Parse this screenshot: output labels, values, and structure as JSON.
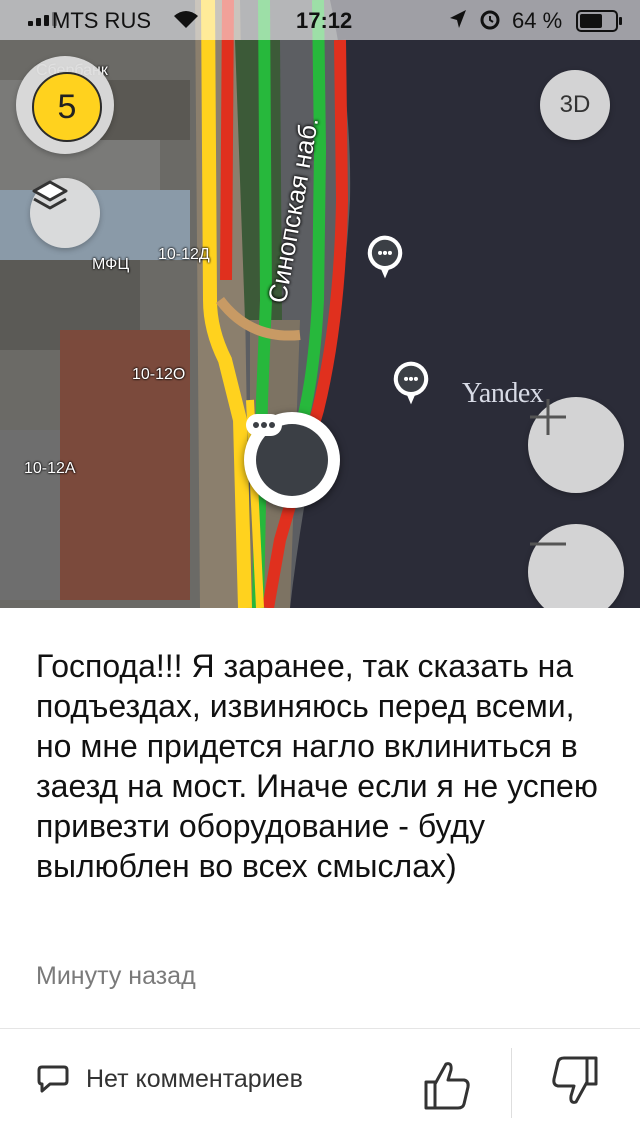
{
  "status_bar": {
    "carrier": "MTS RUS",
    "time": "17:12",
    "battery": "64 %"
  },
  "map": {
    "score_badge": "5",
    "btn_3d": "3D",
    "labels": {
      "bank": "Сбербанк",
      "mfc": "МФЦ",
      "b1": "10-12Д",
      "b2": "10-12О",
      "b3": "10-12А"
    },
    "street_name": "Синопская наб.",
    "watermark": "Yandex"
  },
  "message": {
    "text": "Господа!!! Я заранее, так сказать на подъездах, извиняюсь перед всеми, но мне придется нагло вклиниться в заезд на мост. Иначе если я не успею привезти оборудование - буду вылюблен во всех смыслах)",
    "time_ago": "Минуту назад"
  },
  "footer": {
    "comments_label": "Нет комментариев"
  },
  "icons": {
    "layers": "layers-icon",
    "zoom_in": "plus-icon",
    "zoom_out": "minus-icon",
    "comment": "comment-bubble-icon",
    "like": "thumbs-up-icon",
    "dislike": "thumbs-down-icon"
  },
  "colors": {
    "traffic_green": "#27b83c",
    "traffic_yellow": "#ffd21e",
    "traffic_red": "#e0301e",
    "water": "#2b2c38",
    "badge": "#ffd21e"
  }
}
